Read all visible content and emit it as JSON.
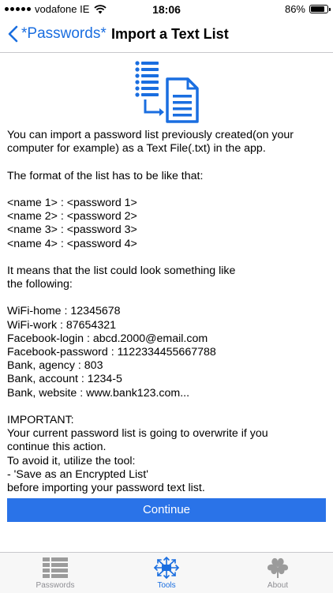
{
  "status": {
    "carrier": "vodafone IE",
    "time": "18:06",
    "battery": "86%",
    "battery_level": 0.86
  },
  "nav": {
    "back_label": "*Passwords*",
    "title": "Import a Text List"
  },
  "content": {
    "lines": [
      "You can import a password list previously created(on your",
      "computer for example) as a Text File(.txt) in the app.",
      "",
      "The format of the list has to be like that:",
      "",
      "<name 1> : <password 1>",
      "<name 2> : <password 2>",
      "<name 3> : <password 3>",
      "<name 4> : <password 4>",
      "",
      "It means that the list could look something like",
      "the following:",
      "",
      "WiFi-home : 12345678",
      "WiFi-work : 87654321",
      "Facebook-login : abcd.2000@email.com",
      "Facebook-password : 1122334455667788",
      "Bank, agency : 803",
      "Bank, account : 1234-5",
      "Bank, website : www.bank123.com...",
      "",
      "IMPORTANT:",
      "Your current password list is going to overwrite if you",
      "continue this action.",
      "To avoid it, utilize the tool:",
      "- 'Save as an Encrypted List'",
      "before importing your password text list."
    ]
  },
  "continue_label": "Continue",
  "tabs": [
    {
      "label": "Passwords",
      "icon": "list-icon"
    },
    {
      "label": "Tools",
      "icon": "tools-icon"
    },
    {
      "label": "About",
      "icon": "clover-icon"
    }
  ],
  "colors": {
    "accent": "#1a6ee0",
    "button": "#2a73e8",
    "icon_gray": "#9b9b9b"
  }
}
